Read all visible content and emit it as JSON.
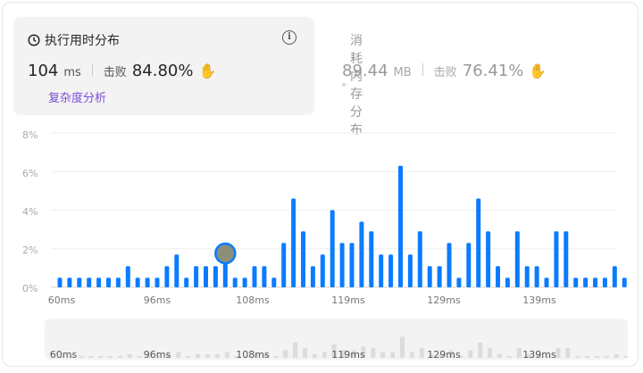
{
  "runtime": {
    "title": "执行用时分布",
    "value": "104",
    "unit": "ms",
    "beat_label": "击败",
    "beat_pct": "84.80%",
    "complexity_link": "复杂度分析",
    "info_icon": "info-icon"
  },
  "memory": {
    "title": "消耗内存分布",
    "value": "89.44",
    "unit": "MB",
    "beat_label": "击败",
    "beat_pct": "76.41%"
  },
  "colors": {
    "bar": "#0a7cff",
    "mini_bar": "#dcdcdc",
    "accent_green": "#2db55d"
  },
  "chart_data": {
    "type": "bar",
    "y_ticks": [
      "8%",
      "6%",
      "4%",
      "2%",
      "0%"
    ],
    "ylim": [
      0,
      8
    ],
    "x_ticks": [
      "60ms",
      "96ms",
      "108ms",
      "119ms",
      "129ms",
      "139ms"
    ],
    "values": [
      0.5,
      0.5,
      0.5,
      0.5,
      0.5,
      0.5,
      0.5,
      1.1,
      0.5,
      0.5,
      0.5,
      1.1,
      1.7,
      0.5,
      1.1,
      1.1,
      1.1,
      1.7,
      0.5,
      0.5,
      1.1,
      1.1,
      0.5,
      2.3,
      4.6,
      2.9,
      1.1,
      1.7,
      4.0,
      2.3,
      2.3,
      3.4,
      2.9,
      1.7,
      1.7,
      6.3,
      1.7,
      2.9,
      1.1,
      1.1,
      2.3,
      0.5,
      2.3,
      4.6,
      2.9,
      1.1,
      0.5,
      2.9,
      1.1,
      1.1,
      0.5,
      2.9,
      2.9,
      0.5,
      0.5,
      0.5,
      0.5,
      1.1,
      0.5
    ],
    "highlight_index": 17
  }
}
